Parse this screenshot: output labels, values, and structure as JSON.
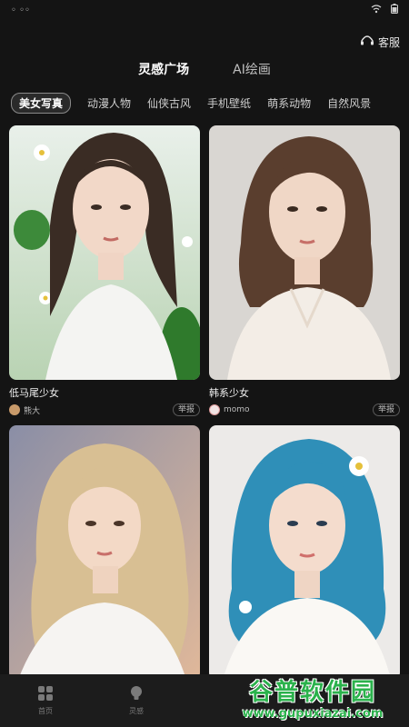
{
  "header": {
    "service_label": "客服"
  },
  "main_tabs": [
    {
      "label": "灵感广场",
      "active": true
    },
    {
      "label": "AI绘画",
      "active": false
    }
  ],
  "categories": [
    {
      "label": "美女写真",
      "active": true
    },
    {
      "label": "动漫人物"
    },
    {
      "label": "仙侠古风"
    },
    {
      "label": "手机壁纸"
    },
    {
      "label": "萌系动物"
    },
    {
      "label": "自然风景"
    }
  ],
  "cards": [
    {
      "title": "低马尾少女",
      "author": "熊大",
      "report": "举报"
    },
    {
      "title": "韩系少女",
      "author": "momo",
      "report": "举报"
    },
    {
      "title": "",
      "author": "",
      "report": ""
    },
    {
      "title": "",
      "author": "",
      "report": ""
    }
  ],
  "bottom_nav": [
    {
      "label": "首页",
      "icon": "grid-icon"
    },
    {
      "label": "灵感",
      "icon": "bulb-icon"
    }
  ],
  "watermark": {
    "title": "谷普软件园",
    "url": "www.gupuxiazai.com"
  },
  "colors": {
    "background": "#141414",
    "watermark_green": "#2bb24c"
  }
}
